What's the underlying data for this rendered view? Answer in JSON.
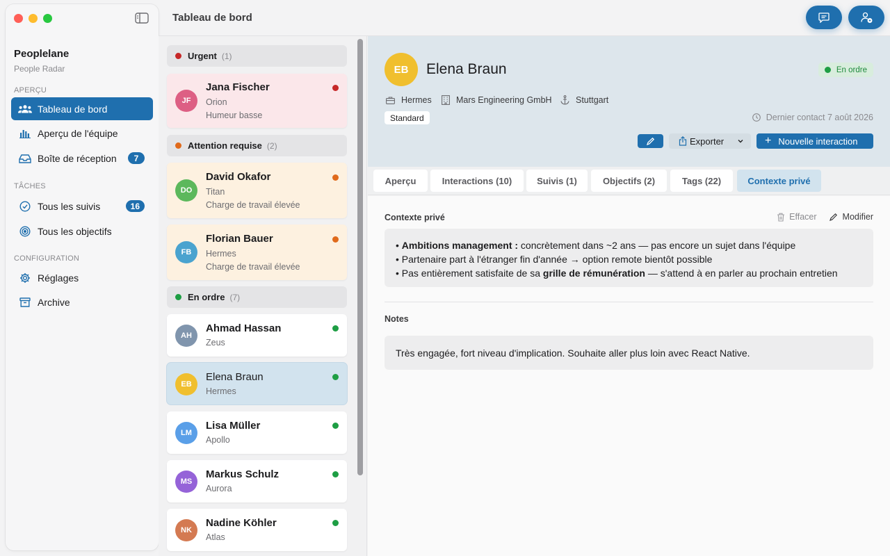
{
  "window": {
    "title": "Tableau de bord"
  },
  "sidebar": {
    "app_name": "Peoplelane",
    "app_subtitle": "People Radar",
    "sections": {
      "overview": "APERÇU",
      "tasks": "TÂCHES",
      "config": "CONFIGURATION"
    },
    "items": [
      {
        "label": "Tableau de bord",
        "icon": "people-icon",
        "active": true
      },
      {
        "label": "Aperçu de l'équipe",
        "icon": "bar-chart-icon"
      },
      {
        "label": "Boîte de réception",
        "icon": "inbox-icon",
        "count": "7"
      },
      {
        "label": "Tous les suivis",
        "icon": "check-circle-icon",
        "count": "16"
      },
      {
        "label": "Tous les objectifs",
        "icon": "target-icon"
      },
      {
        "label": "Réglages",
        "icon": "gear-icon"
      },
      {
        "label": "Archive",
        "icon": "archive-icon"
      }
    ]
  },
  "header": {
    "chat_button": "chat-icon",
    "add_person_button": "person-add-icon"
  },
  "list": {
    "groups": [
      {
        "label": "Urgent",
        "count": "(1)",
        "color": "#c62828"
      },
      {
        "label": "Attention requise",
        "count": "(2)",
        "color": "#e06a1b"
      },
      {
        "label": "En ordre",
        "count": "(7)",
        "color": "#1e9e44"
      }
    ],
    "people": [
      {
        "initials": "JF",
        "name": "Jana Fischer",
        "team": "Orion",
        "note": "Humeur basse",
        "avatar_color": "#dd5f84",
        "status_color": "#c62828"
      },
      {
        "initials": "DO",
        "name": "David Okafor",
        "team": "Titan",
        "note": "Charge de travail élevée",
        "avatar_color": "#5cb85c",
        "status_color": "#e06a1b"
      },
      {
        "initials": "FB",
        "name": "Florian Bauer",
        "team": "Hermes",
        "note": "Charge de travail élevée",
        "avatar_color": "#4aa3cf",
        "status_color": "#e06a1b"
      },
      {
        "initials": "AH",
        "name": "Ahmad Hassan",
        "team": "Zeus",
        "avatar_color": "#8095ad",
        "status_color": "#1e9e44"
      },
      {
        "initials": "EB",
        "name": "Elena Braun",
        "team": "Hermes",
        "avatar_color": "#f0bf2e",
        "status_color": "#1e9e44"
      },
      {
        "initials": "LM",
        "name": "Lisa Müller",
        "team": "Apollo",
        "avatar_color": "#5a9fe8",
        "status_color": "#1e9e44"
      },
      {
        "initials": "MS",
        "name": "Markus Schulz",
        "team": "Aurora",
        "avatar_color": "#9563d8",
        "status_color": "#1e9e44"
      },
      {
        "initials": "NK",
        "name": "Nadine Köhler",
        "team": "Atlas",
        "avatar_color": "#d47a52",
        "status_color": "#1e9e44"
      }
    ]
  },
  "detail": {
    "initials": "EB",
    "name": "Elena Braun",
    "status": "En ordre",
    "team": "Hermes",
    "company": "Mars Engineering GmbH",
    "location": "Stuttgart",
    "tier": "Standard",
    "last_contact": "Dernier contact 7 août 2026",
    "export_label": "Exporter",
    "new_interaction_label": "Nouvelle interaction",
    "tabs": [
      {
        "label": "Aperçu"
      },
      {
        "label": "Interactions (10)"
      },
      {
        "label": "Suivis (1)"
      },
      {
        "label": "Objectifs (2)"
      },
      {
        "label": "Tags (22)"
      },
      {
        "label": "Contexte privé",
        "active": true
      }
    ],
    "private_context": {
      "heading": "Contexte privé",
      "clear_label": "Effacer",
      "edit_label": "Modifier",
      "bullet1_bold": "Ambitions management :",
      "bullet1_rest": " concrètement dans ~2 ans — pas encore un sujet dans l'équipe",
      "bullet2": "Partenaire part à l'étranger fin d'année → option remote bientôt possible",
      "bullet3_pre": "Pas entièrement satisfaite de sa ",
      "bullet3_bold": "grille de rémunération",
      "bullet3_post": " — s'attend à en parler au prochain entretien"
    },
    "notes": {
      "heading": "Notes",
      "text": "Très engagée, fort niveau d'implication. Souhaite aller plus loin avec React Native."
    }
  }
}
